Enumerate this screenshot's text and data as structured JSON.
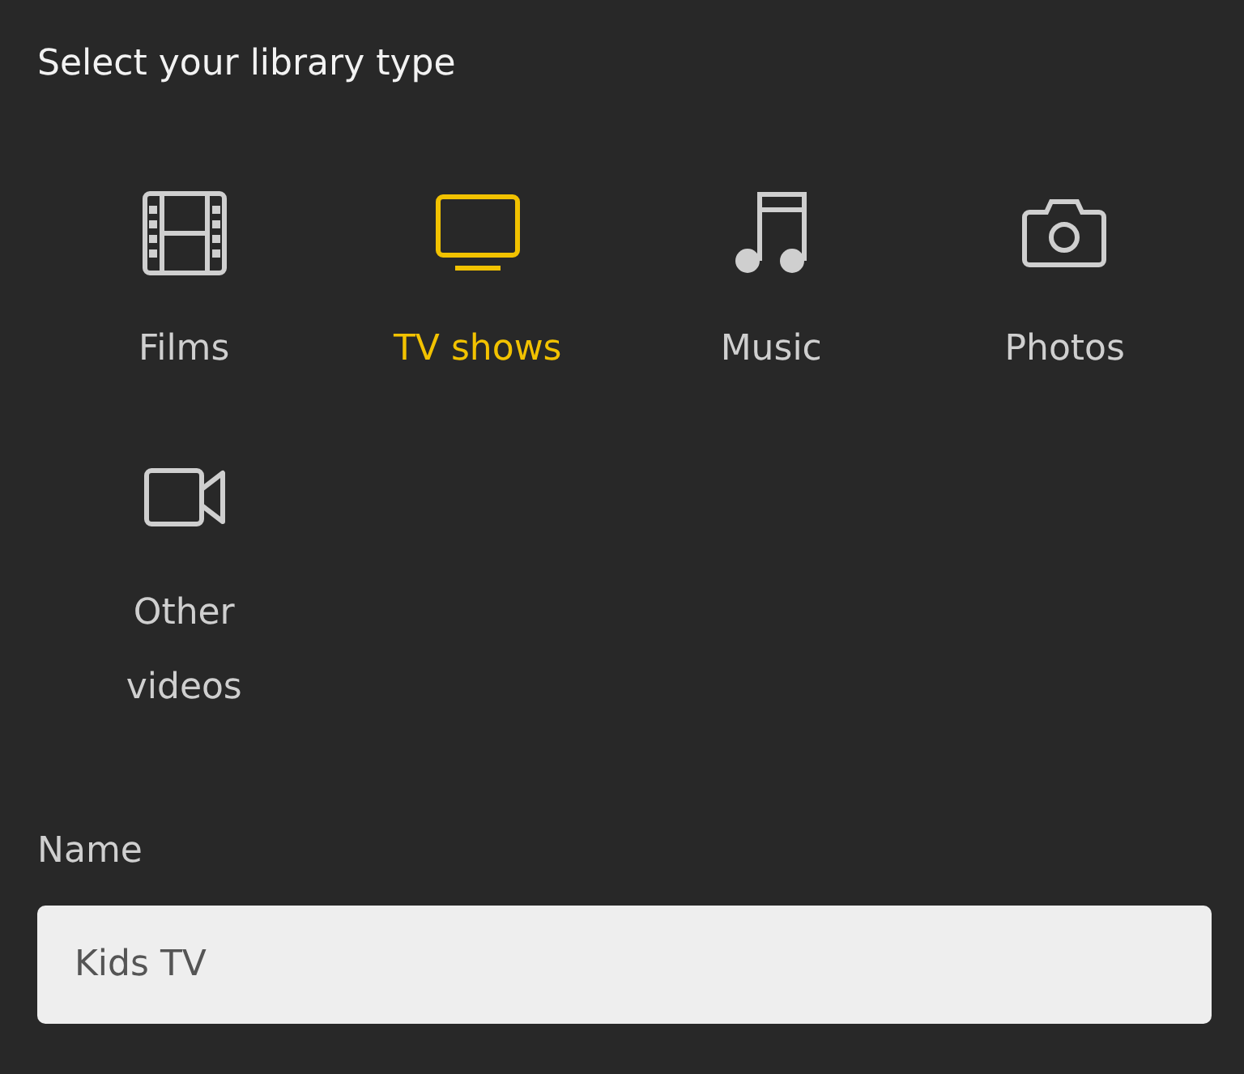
{
  "title": "Select your library type",
  "library_types": [
    {
      "label": "Films",
      "selected": false
    },
    {
      "label": "TV shows",
      "selected": true
    },
    {
      "label": "Music",
      "selected": false
    },
    {
      "label": "Photos",
      "selected": false
    },
    {
      "label": "Other videos",
      "selected": false
    }
  ],
  "name_field": {
    "label": "Name",
    "value": "Kids TV"
  }
}
